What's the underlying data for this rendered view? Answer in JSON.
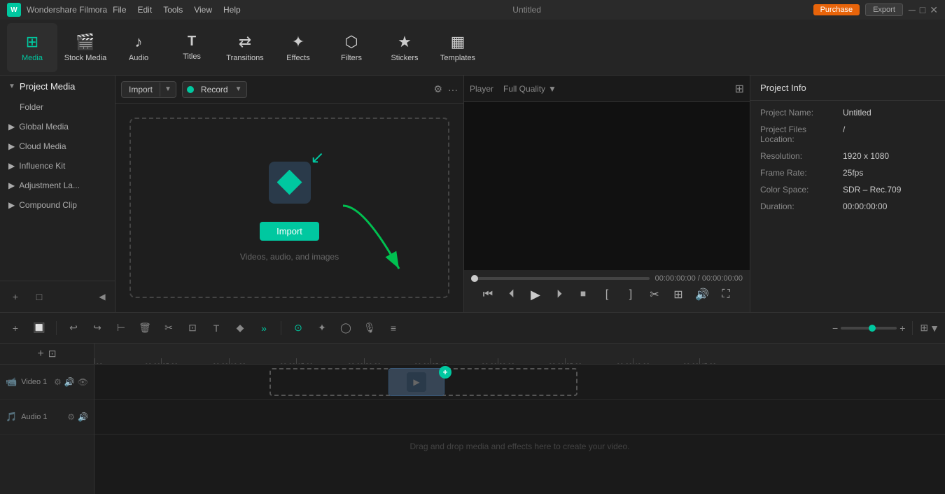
{
  "app": {
    "brand": "Wondershare Filmora",
    "title": "Untitled",
    "purchase_label": "Purchase",
    "export_label": "Export"
  },
  "titlebar": {
    "menus": [
      "File",
      "Edit",
      "Tools",
      "View",
      "Help"
    ],
    "win_controls": [
      "─",
      "□",
      "✕"
    ]
  },
  "toolbar": {
    "items": [
      {
        "id": "media",
        "label": "Media",
        "icon": "⊞",
        "active": true
      },
      {
        "id": "stock-media",
        "label": "Stock Media",
        "icon": "🎬"
      },
      {
        "id": "audio",
        "label": "Audio",
        "icon": "♪"
      },
      {
        "id": "titles",
        "label": "Titles",
        "icon": "T"
      },
      {
        "id": "transitions",
        "label": "Transitions",
        "icon": "⇄"
      },
      {
        "id": "effects",
        "label": "Effects",
        "icon": "✦"
      },
      {
        "id": "filters",
        "label": "Filters",
        "icon": "⬡"
      },
      {
        "id": "stickers",
        "label": "Stickers",
        "icon": "★"
      },
      {
        "id": "templates",
        "label": "Templates",
        "icon": "▦"
      }
    ]
  },
  "sidebar": {
    "header": "Project Media",
    "items": [
      {
        "id": "folder",
        "label": "Folder"
      },
      {
        "id": "global-media",
        "label": "Global Media"
      },
      {
        "id": "cloud-media",
        "label": "Cloud Media"
      },
      {
        "id": "influence-kit",
        "label": "Influence Kit"
      },
      {
        "id": "adjustment-layer",
        "label": "Adjustment La..."
      },
      {
        "id": "compound-clip",
        "label": "Compound Clip"
      }
    ]
  },
  "media_panel": {
    "import_label": "Import",
    "record_label": "Record",
    "import_btn_label": "Import",
    "subtitle": "Videos, audio, and images"
  },
  "player": {
    "tab_label": "Player",
    "quality_label": "Full Quality",
    "current_time": "00:00:00:00",
    "total_time": "00:00:00:00"
  },
  "project_info": {
    "title": "Project Info",
    "fields": [
      {
        "label": "Project Name:",
        "value": "Untitled"
      },
      {
        "label": "Project Files\nLocation:",
        "value": "/"
      },
      {
        "label": "Resolution:",
        "value": "1920 x 1080"
      },
      {
        "label": "Frame Rate:",
        "value": "25fps"
      },
      {
        "label": "Color Space:",
        "value": "SDR - Rec.709"
      },
      {
        "label": "Duration:",
        "value": "00:00:00:00"
      }
    ]
  },
  "timeline": {
    "ruler_marks": [
      "00:00",
      "00:00:05:00",
      "00:00:10:00",
      "00:00:15:00",
      "00:00:20:00",
      "00:00:25:00",
      "00:00:30:00",
      "00:00:35:00",
      "00:00:40:00",
      "00:00:45:00"
    ],
    "tracks": [
      {
        "id": "video1",
        "label": "Video 1",
        "icon": "🎥"
      },
      {
        "id": "audio1",
        "label": "Audio 1",
        "icon": "🎵"
      }
    ],
    "drop_text": "Drag and drop media and effects here to create your video."
  }
}
